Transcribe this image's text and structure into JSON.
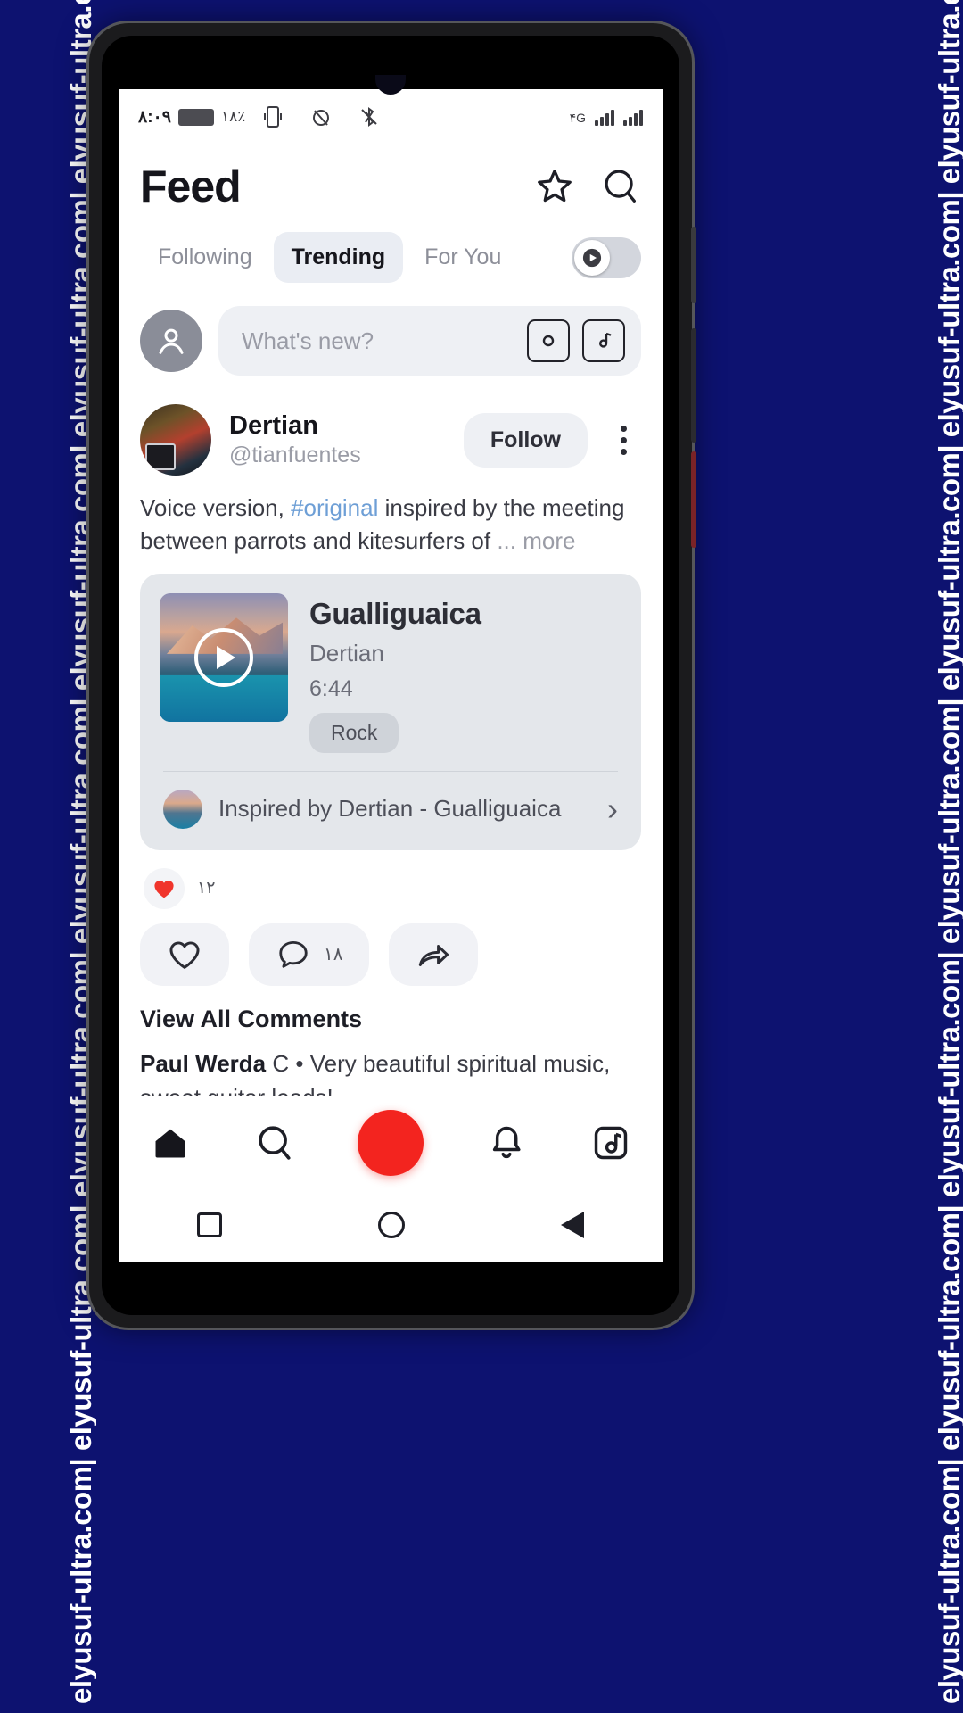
{
  "watermark": {
    "text": "elyusuf-ultra.com| elyusuf-ultra.com| elyusuf-ultra.com| elyusuf-ultra.com| elyusuf-ultra.com| elyusuf-ultra.com| elyusuf-ultra.com| elyusuf-ultra.com|"
  },
  "statusbar": {
    "time": "۸:۰۹",
    "glyphs": "۱۸٪",
    "signal_label": "۴G",
    "icons": [
      "battery-icon",
      "vibrate-icon",
      "alarm-off-icon",
      "bluetooth-off-icon",
      "signal-icon",
      "wifi-icon"
    ]
  },
  "header": {
    "title": "Feed",
    "star_icon": "star-icon",
    "search_icon": "search-icon"
  },
  "tabs": {
    "items": [
      {
        "label": "Following",
        "active": false
      },
      {
        "label": "Trending",
        "active": true
      },
      {
        "label": "For You",
        "active": false
      }
    ],
    "toggle_icon": "play-toggle-icon"
  },
  "composer": {
    "avatar_icon": "user-avatar-icon",
    "placeholder": "What's new?",
    "camera_icon": "camera-icon",
    "music_icon": "music-note-icon"
  },
  "post": {
    "author_name": "Dertian",
    "author_handle": "@tianfuentes",
    "follow_label": "Follow",
    "more_icon": "more-vertical-icon",
    "caption_pre": "Voice version, ",
    "caption_tag": "#original",
    "caption_post": " inspired by the meeting between parrots and kitesurfers of ",
    "caption_ellipsis": "... ",
    "caption_more": "more",
    "music": {
      "title": "Gualliguaica",
      "artist": "Dertian",
      "duration": "6:44",
      "genre": "Rock",
      "play_icon": "play-icon",
      "inspired_text": "Inspired by Dertian - Gualliguaica",
      "chevron_icon": "chevron-right-icon"
    },
    "reactions": {
      "heart_icon": "heart-filled-icon",
      "count": "۱۲"
    },
    "actions": [
      {
        "icon": "heart-outline-icon",
        "count": ""
      },
      {
        "icon": "comment-icon",
        "count": "۱۸"
      },
      {
        "icon": "share-icon",
        "count": ""
      }
    ],
    "comments": {
      "view_all_label": "View All Comments",
      "first_author": "Paul Werda",
      "first_badge": "C",
      "first_text": "• Very beautiful spiritual music, sweet guitar leads!"
    }
  },
  "bottom_nav": {
    "items": [
      {
        "icon": "home-icon",
        "active": true
      },
      {
        "icon": "search-icon",
        "active": false
      },
      {
        "icon": "add-icon",
        "active": false
      },
      {
        "icon": "bell-icon",
        "active": false
      },
      {
        "icon": "music-library-icon",
        "active": false
      }
    ]
  },
  "system_nav": {
    "recent_icon": "recent-apps-icon",
    "home_icon": "home-circle-icon",
    "back_icon": "back-triangle-icon"
  },
  "colors": {
    "background": "#0d1270",
    "accent_red": "#f3241f",
    "link_blue": "#6e9fd6",
    "chip_gray": "#eef0f4"
  }
}
